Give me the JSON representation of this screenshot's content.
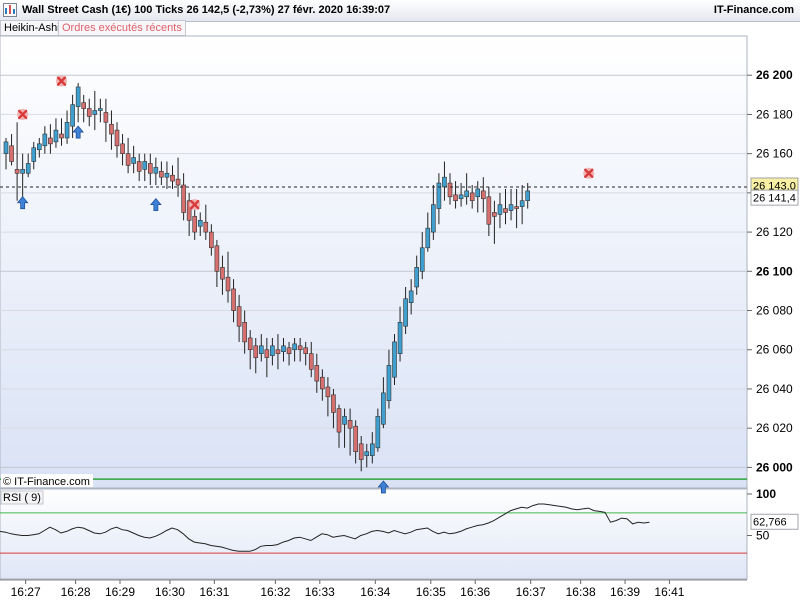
{
  "header": {
    "title": "Wall Street Cash (1€)   100 Ticks   26 142,5 (-2,73%)   27 févr. 2020 16:39:07",
    "brand": "IT-Finance.com"
  },
  "toolbar": {
    "heikin_ashi_label": "Heikin-Ashi",
    "orders_label": "Ordres exécutés récents"
  },
  "copyright": "© IT-Finance.com",
  "rsi_panel": {
    "label": "RSI ( 9)"
  },
  "chart_data": [
    {
      "type": "candlestick",
      "title": "Wall Street Cash (1€)",
      "style": "Heikin-Ashi",
      "ylim": [
        25990,
        26220
      ],
      "y_ticks": [
        {
          "value": 26000,
          "label": "26 000",
          "bold": true
        },
        {
          "value": 26020,
          "label": "26 020",
          "bold": false
        },
        {
          "value": 26040,
          "label": "26 040",
          "bold": false
        },
        {
          "value": 26060,
          "label": "26 060",
          "bold": false
        },
        {
          "value": 26080,
          "label": "26 080",
          "bold": false
        },
        {
          "value": 26100,
          "label": "26 100",
          "bold": true
        },
        {
          "value": 26120,
          "label": "26 120",
          "bold": false
        },
        {
          "value": 26140,
          "label": "26 140",
          "bold": false
        },
        {
          "value": 26160,
          "label": "26 160",
          "bold": false
        },
        {
          "value": 26180,
          "label": "26 180",
          "bold": false
        },
        {
          "value": 26200,
          "label": "26 200",
          "bold": true
        }
      ],
      "x_ticks": [
        "16:27",
        "16:28",
        "16:29",
        "16:30",
        "16:31",
        "16:32",
        "16:33",
        "16:34",
        "16:35",
        "16:36",
        "16:37",
        "16:38",
        "16:39",
        "16:41"
      ],
      "x_tick_index": [
        3,
        12,
        20,
        29,
        37,
        48,
        56,
        66,
        76,
        84,
        94,
        103,
        111,
        119
      ],
      "price_labels": [
        {
          "value": 26143.0,
          "label": "26 143,0",
          "style": "highlight"
        },
        {
          "value": 26141.4,
          "label": "26 141,4",
          "style": "plain"
        }
      ],
      "reference_line": {
        "value": 26143.0,
        "style": "dashed"
      },
      "support_line": {
        "value": 25994,
        "color": "#2fa53a"
      },
      "up_color": "#3fa0d0",
      "down_color": "#d86f6f",
      "candles": [
        [
          26160,
          26166,
          26152,
          26168
        ],
        [
          26164,
          26156,
          26154,
          26170
        ],
        [
          26152,
          26150,
          26136,
          26176
        ],
        [
          26150,
          26152,
          26138,
          26160
        ],
        [
          26150,
          26155,
          26148,
          26160
        ],
        [
          26156,
          26163,
          26152,
          26166
        ],
        [
          26162,
          26165,
          26158,
          26168
        ],
        [
          26164,
          26170,
          26160,
          26174
        ],
        [
          26168,
          26165,
          26160,
          26175
        ],
        [
          26166,
          26172,
          26163,
          26178
        ],
        [
          26170,
          26168,
          26164,
          26178
        ],
        [
          26168,
          26176,
          26165,
          26182
        ],
        [
          26174,
          26185,
          26168,
          26190
        ],
        [
          26184,
          26194,
          26176,
          26196
        ],
        [
          26186,
          26183,
          26176,
          26190
        ],
        [
          26183,
          26179,
          26174,
          26188
        ],
        [
          26180,
          26182,
          26172,
          26192
        ],
        [
          26182,
          26183,
          26176,
          26188
        ],
        [
          26181,
          26176,
          26166,
          26188
        ],
        [
          26175,
          26170,
          26162,
          26182
        ],
        [
          26172,
          26164,
          26158,
          26176
        ],
        [
          26165,
          26160,
          26154,
          26170
        ],
        [
          26160,
          26154,
          26150,
          26168
        ],
        [
          26155,
          26158,
          26150,
          26164
        ],
        [
          26156,
          26151,
          26146,
          26160
        ],
        [
          26152,
          26156,
          26146,
          26160
        ],
        [
          26155,
          26150,
          26144,
          26160
        ],
        [
          26150,
          26153,
          26144,
          26158
        ],
        [
          26151,
          26148,
          26144,
          26156
        ],
        [
          26148,
          26150,
          26142,
          26156
        ],
        [
          26149,
          26146,
          26142,
          26154
        ],
        [
          26147,
          26144,
          26138,
          26158
        ],
        [
          26144,
          26130,
          26126,
          26150
        ],
        [
          26136,
          26126,
          26118,
          26140
        ],
        [
          26128,
          26120,
          26116,
          26132
        ],
        [
          26123,
          26126,
          26118,
          26130
        ],
        [
          26125,
          26120,
          26116,
          26134
        ],
        [
          26120,
          26112,
          26108,
          26124
        ],
        [
          26113,
          26100,
          26092,
          26116
        ],
        [
          26102,
          26096,
          26088,
          26108
        ],
        [
          26097,
          26090,
          26084,
          26110
        ],
        [
          26091,
          26080,
          26074,
          26096
        ],
        [
          26082,
          26072,
          26064,
          26088
        ],
        [
          26074,
          26064,
          26058,
          26080
        ],
        [
          26066,
          26060,
          26050,
          26070
        ],
        [
          26062,
          26056,
          26048,
          26066
        ],
        [
          26058,
          26062,
          26054,
          26068
        ],
        [
          26060,
          26056,
          26046,
          26066
        ],
        [
          26057,
          26062,
          26052,
          26066
        ],
        [
          26060,
          26058,
          26050,
          26068
        ],
        [
          26059,
          26062,
          26054,
          26066
        ],
        [
          26061,
          26058,
          26052,
          26064
        ],
        [
          26060,
          26063,
          26054,
          26066
        ],
        [
          26062,
          26060,
          26054,
          26066
        ],
        [
          26061,
          26058,
          26052,
          26064
        ],
        [
          26058,
          26050,
          26046,
          26064
        ],
        [
          26052,
          26044,
          26038,
          26058
        ],
        [
          26046,
          26040,
          26034,
          26050
        ],
        [
          26041,
          26036,
          26026,
          26046
        ],
        [
          26037,
          26028,
          26020,
          26040
        ],
        [
          26030,
          26018,
          26010,
          26032
        ],
        [
          26022,
          26026,
          26010,
          26030
        ],
        [
          26024,
          26020,
          26006,
          26030
        ],
        [
          26021,
          26008,
          26002,
          26024
        ],
        [
          26012,
          26004,
          25998,
          26016
        ],
        [
          26006,
          26008,
          26000,
          26012
        ],
        [
          26006,
          26012,
          26002,
          26018
        ],
        [
          26010,
          26026,
          26008,
          26030
        ],
        [
          26022,
          26038,
          26020,
          26046
        ],
        [
          26034,
          26052,
          26030,
          26060
        ],
        [
          26046,
          26064,
          26042,
          26068
        ],
        [
          26058,
          26074,
          26054,
          26082
        ],
        [
          26072,
          26086,
          26068,
          26092
        ],
        [
          26084,
          26090,
          26078,
          26096
        ],
        [
          26092,
          26102,
          26088,
          26108
        ],
        [
          26100,
          26112,
          26096,
          26120
        ],
        [
          26112,
          26122,
          26110,
          26130
        ],
        [
          26120,
          26134,
          26116,
          26144
        ],
        [
          26132,
          26145,
          26124,
          26150
        ],
        [
          26143,
          26148,
          26136,
          26156
        ],
        [
          26145,
          26138,
          26134,
          26150
        ],
        [
          26139,
          26136,
          26132,
          26146
        ],
        [
          26137,
          26139,
          26133,
          26145
        ],
        [
          26138,
          26141,
          26134,
          26150
        ],
        [
          26140,
          26136,
          26132,
          26144
        ],
        [
          26138,
          26142,
          26130,
          26146
        ],
        [
          26141,
          26137,
          26130,
          26148
        ],
        [
          26138,
          26124,
          26118,
          26143
        ],
        [
          26130,
          26128,
          26114,
          26136
        ],
        [
          26129,
          26134,
          26122,
          26140
        ],
        [
          26132,
          26130,
          26124,
          26142
        ],
        [
          26131,
          26134,
          26126,
          26142
        ],
        [
          26133,
          26132,
          26122,
          26142
        ],
        [
          26133,
          26136,
          26124,
          26144
        ],
        [
          26136,
          26141,
          26132,
          26145
        ]
      ],
      "markers": [
        {
          "index": 3,
          "kind": "buy",
          "price": 26135
        },
        {
          "index": 3,
          "kind": "executed",
          "price": 26180
        },
        {
          "index": 10,
          "kind": "executed",
          "price": 26197
        },
        {
          "index": 13,
          "kind": "buy",
          "price": 26171
        },
        {
          "index": 27,
          "kind": "buy",
          "price": 26134
        },
        {
          "index": 34,
          "kind": "executed",
          "price": 26134
        },
        {
          "index": 68,
          "kind": "buy",
          "price": 25990
        },
        {
          "index": 105,
          "kind": "executed",
          "price": 26150
        }
      ]
    },
    {
      "type": "line",
      "title": "RSI ( 9)",
      "ylim": [
        0,
        100
      ],
      "y_ticks": [
        {
          "value": 50,
          "label": "50"
        },
        {
          "value": 100,
          "label": "100"
        }
      ],
      "overbought": 70,
      "oversold": 30,
      "last_value_label": "62,766",
      "values": [
        55,
        54,
        52,
        51,
        50,
        50,
        51,
        52,
        56,
        60,
        57,
        53,
        55,
        58,
        60,
        59,
        56,
        53,
        52,
        54,
        58,
        60,
        57,
        56,
        53,
        50,
        48,
        47,
        49,
        52,
        56,
        59,
        57,
        52,
        46,
        42,
        41,
        40,
        38,
        37,
        36,
        34,
        32,
        31,
        31,
        31,
        33,
        37,
        38,
        38,
        39,
        42,
        44,
        47,
        48,
        46,
        44,
        48,
        52,
        51,
        48,
        49,
        50,
        48,
        46,
        50,
        52,
        55,
        56,
        55,
        53,
        56,
        54,
        52,
        54,
        57,
        58,
        59,
        55,
        52,
        54,
        52,
        53,
        55,
        58,
        60,
        62,
        63,
        65,
        68,
        72,
        76,
        80,
        82,
        84,
        83,
        86,
        88,
        88,
        87,
        86,
        85,
        84,
        82,
        81,
        82,
        83,
        80,
        79,
        78,
        66,
        68,
        71,
        70,
        64,
        66,
        65,
        66
      ]
    }
  ]
}
